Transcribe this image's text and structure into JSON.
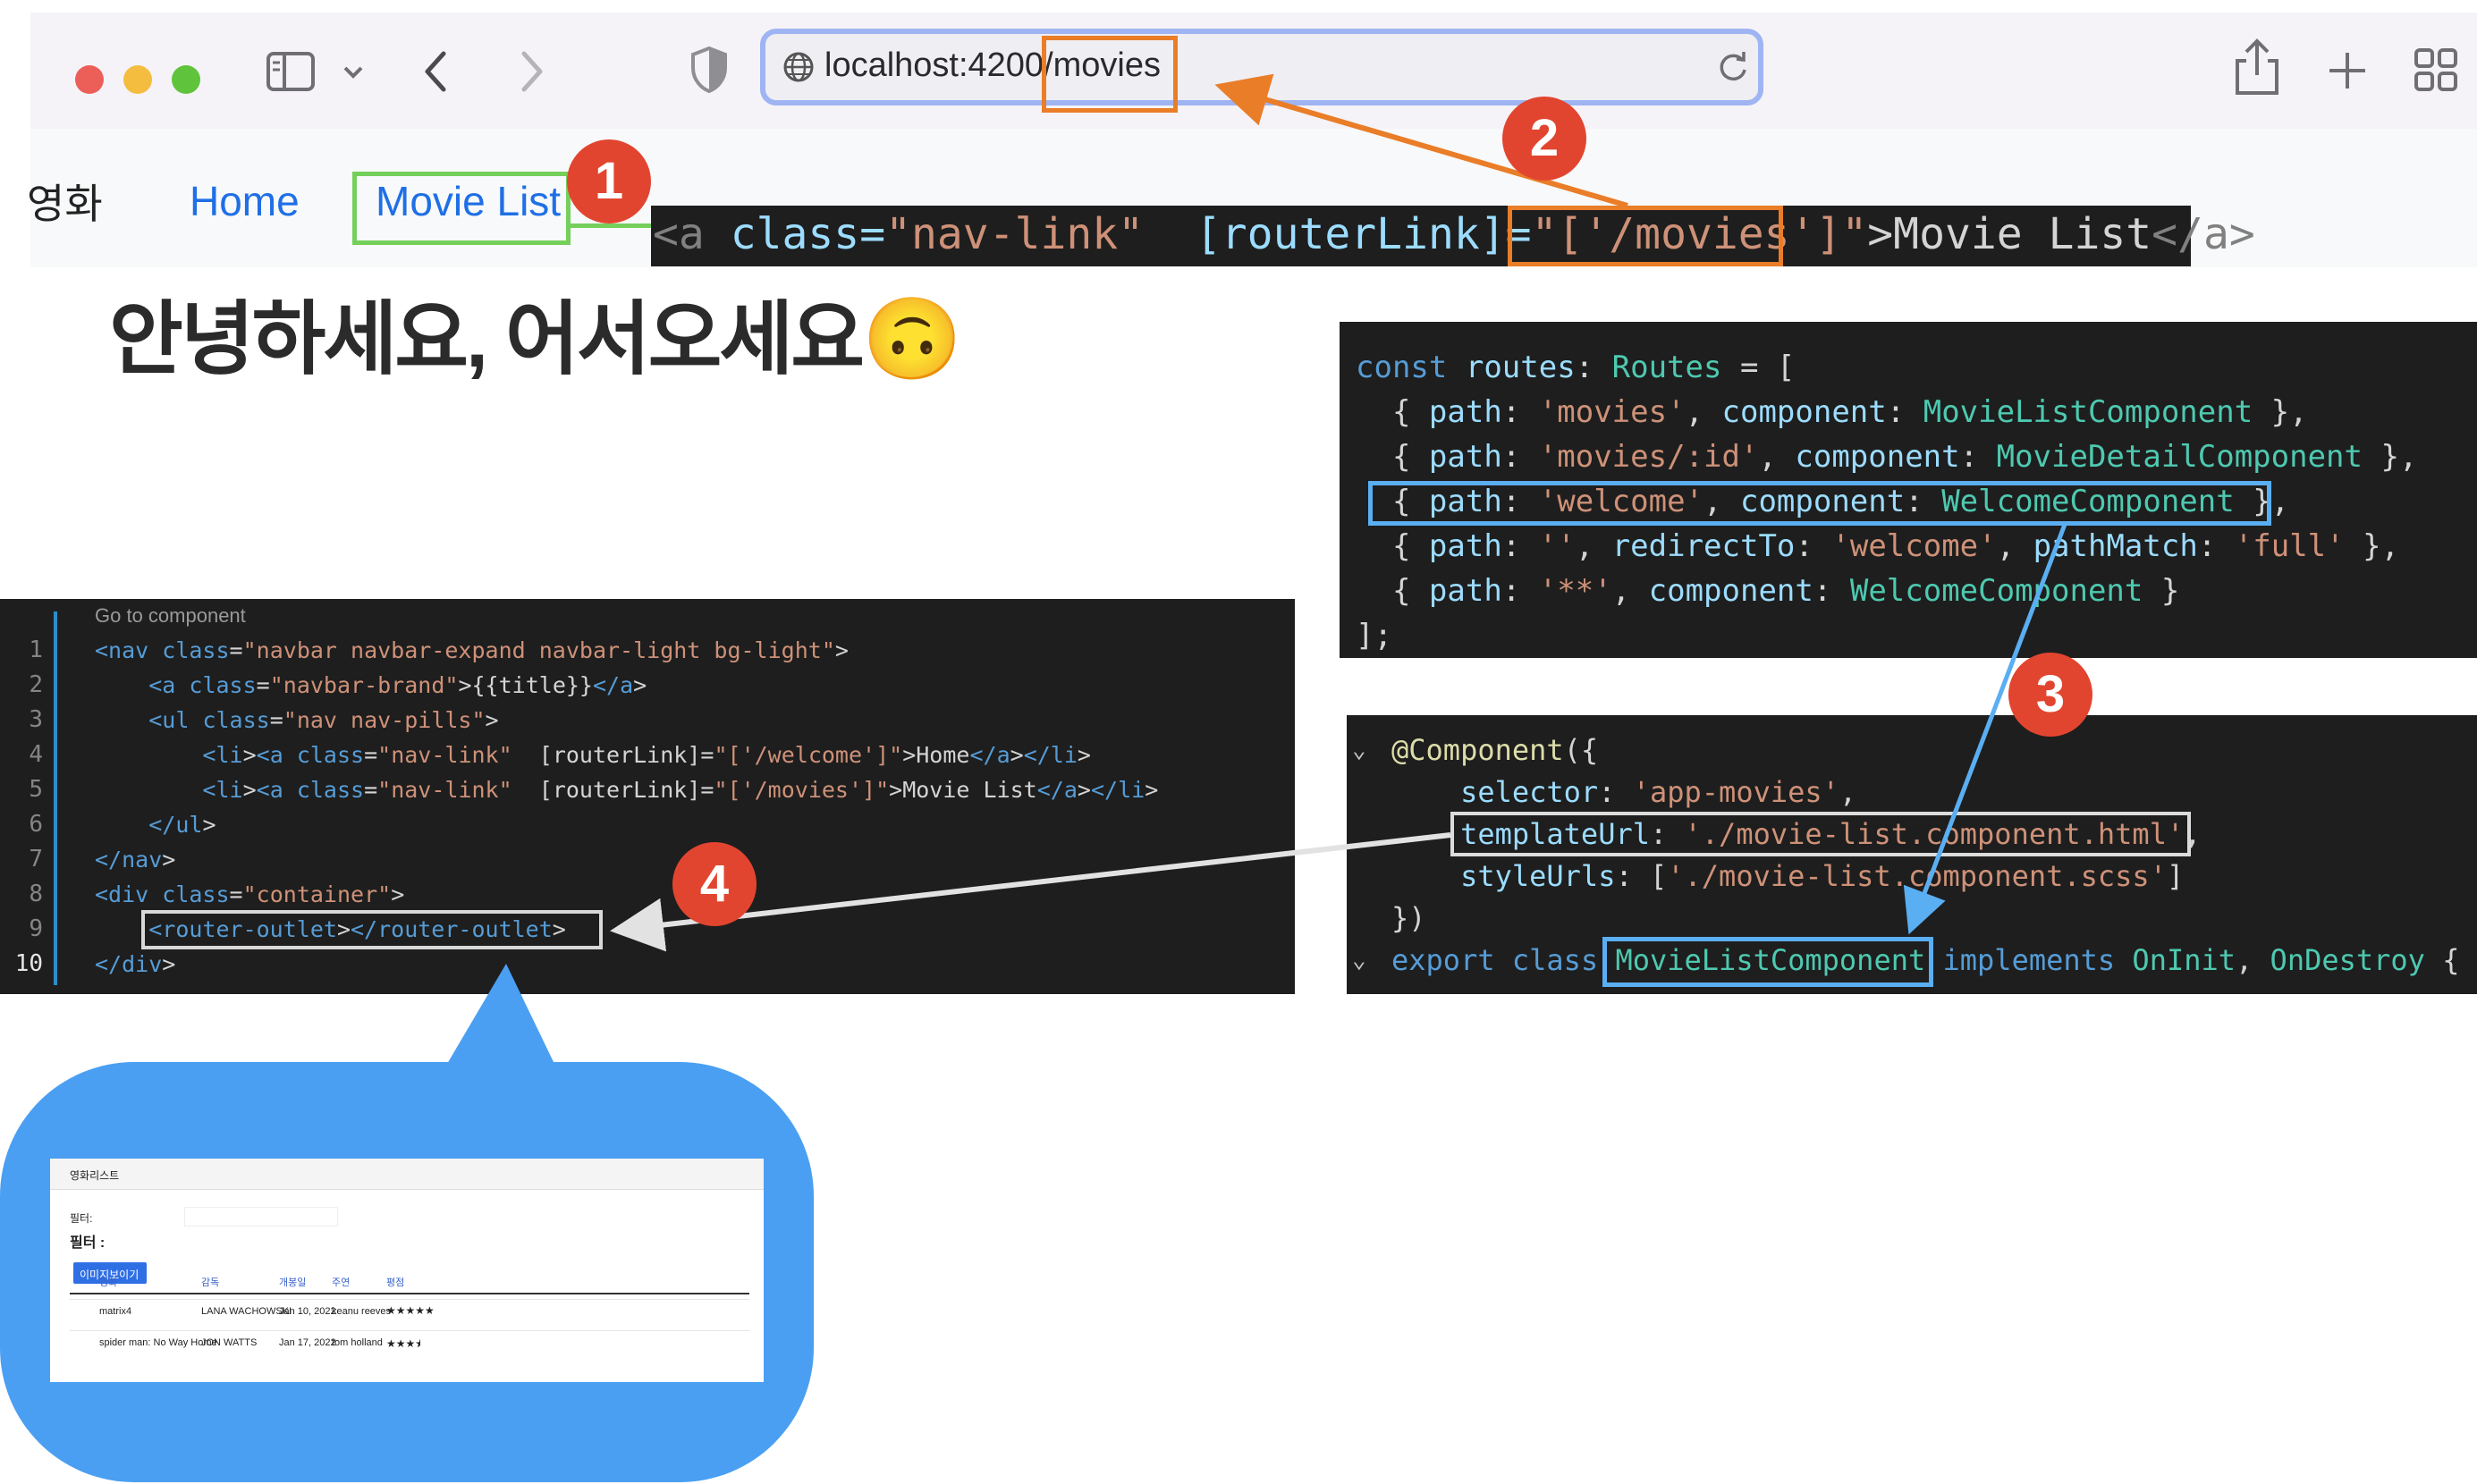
{
  "browser": {
    "url": "localhost:4200/movies",
    "colors": {
      "close": "#ec5f58",
      "minimize": "#f4bd40",
      "zoom": "#5fc43b",
      "url_border": "#9fb4f2"
    }
  },
  "page": {
    "brand": "영화",
    "nav_home": "Home",
    "nav_movie_list": "Movie List",
    "greeting": "안녕하세요, 어서오세요🙃"
  },
  "code_nav_link": {
    "open": "<a",
    "attr1": " class=",
    "val1": "\"nav-link\"",
    "attr2": "  [routerLink]=",
    "q1": "\"",
    "val2": "['/movies']",
    "q2": "\"",
    "text": ">Movie List",
    "close": "</a>"
  },
  "routes_code": {
    "lines": [
      "const routes: Routes = [",
      "  { path: 'movies', component: MovieListComponent },",
      "  { path: 'movies/:id', component: MovieDetailComponent },",
      "  { path: 'welcome', component: WelcomeComponent },",
      "  { path: '', redirectTo: 'welcome', pathMatch: 'full' },",
      "  { path: '**', component: WelcomeComponent }",
      "];"
    ]
  },
  "template_code": {
    "codelens": "Go to component",
    "line_numbers": [
      "1",
      "2",
      "3",
      "4",
      "5",
      "6",
      "7",
      "8",
      "9",
      "10"
    ],
    "lines": [
      "<nav class=\"navbar navbar-expand navbar-light bg-light\">",
      "    <a class=\"navbar-brand\">{{title}}</a>",
      "    <ul class=\"nav nav-pills\">",
      "        <li><a class=\"nav-link\"  [routerLink]=\"['/welcome']\">Home</a></li>",
      "        <li><a class=\"nav-link\"  [routerLink]=\"['/movies']\">Movie List</a></li>",
      "    </ul>",
      "</nav>",
      "<div class=\"container\">",
      "    <router-outlet></router-outlet>",
      "</div>"
    ]
  },
  "component_code": {
    "lines": [
      "@Component({",
      "    selector: 'app-movies',",
      "    templateUrl: './movie-list.component.html',",
      "    styleUrls: ['./movie-list.component.scss']",
      "})",
      "export class MovieListComponent implements OnInit, OnDestroy {"
    ]
  },
  "badges": [
    "1",
    "2",
    "3",
    "4"
  ],
  "preview": {
    "title": "영화리스트",
    "filter_label": "필터:",
    "filter_heading": "필터 :",
    "show_image_button": "이미지보이기",
    "columns": [
      "영화",
      "감독",
      "개봉일",
      "주연",
      "평점"
    ],
    "rows": [
      {
        "movie": "matrix4",
        "director": "LANA WACHOWSKI",
        "release": "Jan 10, 2022",
        "star": "keanu reeves",
        "rating": 5
      },
      {
        "movie": "spider man: No Way Home",
        "director": "JON WATTS",
        "release": "Jan 17, 2022",
        "star": "tom holland",
        "rating": 3.5
      }
    ]
  }
}
